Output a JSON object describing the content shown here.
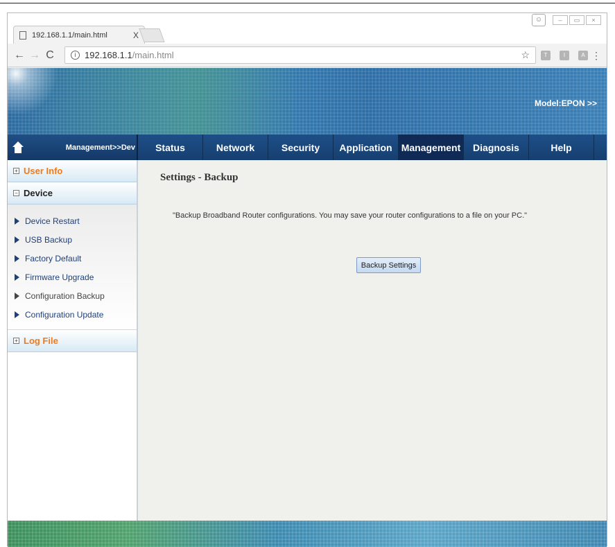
{
  "browser": {
    "tab_title": "192.168.1.1/main.html",
    "tab_close": "X",
    "url_host": "192.168.1.1",
    "url_path": "/main.html",
    "info_glyph": "i",
    "star_glyph": "☆",
    "menu_glyph": "⋮",
    "back_glyph": "←",
    "forward_glyph": "→",
    "reload_glyph": "C",
    "extensions": [
      "T",
      "I",
      "A"
    ],
    "window_buttons": [
      "–",
      "▭",
      "×"
    ]
  },
  "banner": {
    "model_label": "Model:EPON >>"
  },
  "breadcrumb": "Management>>Dev",
  "menu": [
    {
      "label": "Status",
      "active": false
    },
    {
      "label": "Network",
      "active": false
    },
    {
      "label": "Security",
      "active": false
    },
    {
      "label": "Application",
      "active": false
    },
    {
      "label": "Management",
      "active": true
    },
    {
      "label": "Diagnosis",
      "active": false
    },
    {
      "label": "Help",
      "active": false
    }
  ],
  "sidebar": {
    "user_info": {
      "label": "User Info",
      "toggle": "+"
    },
    "device": {
      "label": "Device",
      "toggle": "−"
    },
    "items": [
      {
        "label": "Device Restart"
      },
      {
        "label": "USB Backup"
      },
      {
        "label": "Factory Default"
      },
      {
        "label": "Firmware Upgrade"
      },
      {
        "label": "Configuration Backup"
      },
      {
        "label": "Configuration Update"
      }
    ],
    "log_file": {
      "label": "Log File",
      "toggle": "+"
    }
  },
  "content": {
    "title": "Settings - Backup",
    "description": "\"Backup Broadband Router configurations. You may save your router configurations to a file on your PC.\"",
    "button_label": "Backup Settings"
  },
  "colors": {
    "menu_bg": "#1d4f87",
    "menu_active": "#0f2a55",
    "sidebar_orange": "#f07a1a",
    "link_blue": "#1f3f7a"
  }
}
